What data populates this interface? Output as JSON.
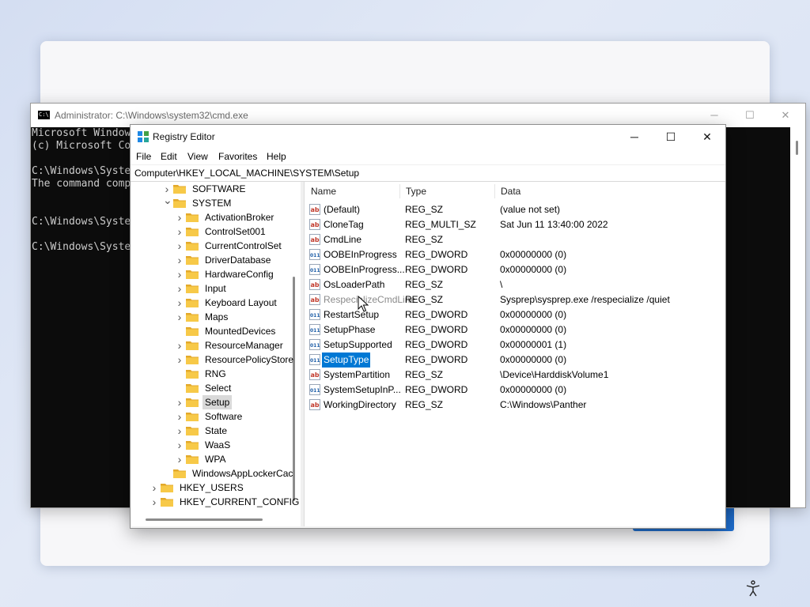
{
  "cmd": {
    "title": "Administrator: C:\\Windows\\system32\\cmd.exe",
    "icon_label": "C:\\",
    "lines": [
      "Microsoft Window",
      "(c) Microsoft Co",
      "",
      "C:\\Windows\\Syste",
      "The command comp",
      "",
      "",
      "C:\\Windows\\Syste",
      "",
      "C:\\Windows\\Syste"
    ]
  },
  "regedit": {
    "title": "Registry Editor",
    "menu": [
      "File",
      "Edit",
      "View",
      "Favorites",
      "Help"
    ],
    "address": "Computer\\HKEY_LOCAL_MACHINE\\SYSTEM\\Setup",
    "tree": [
      {
        "label": "SOFTWARE",
        "expander": "collapsed",
        "level": 1
      },
      {
        "label": "SYSTEM",
        "expander": "expanded",
        "level": 1
      },
      {
        "label": "ActivationBroker",
        "expander": "collapsed",
        "level": 2
      },
      {
        "label": "ControlSet001",
        "expander": "collapsed",
        "level": 2
      },
      {
        "label": "CurrentControlSet",
        "expander": "collapsed",
        "level": 2
      },
      {
        "label": "DriverDatabase",
        "expander": "collapsed",
        "level": 2
      },
      {
        "label": "HardwareConfig",
        "expander": "collapsed",
        "level": 2
      },
      {
        "label": "Input",
        "expander": "collapsed",
        "level": 2
      },
      {
        "label": "Keyboard Layout",
        "expander": "collapsed",
        "level": 2
      },
      {
        "label": "Maps",
        "expander": "collapsed",
        "level": 2
      },
      {
        "label": "MountedDevices",
        "expander": "none",
        "level": 2
      },
      {
        "label": "ResourceManager",
        "expander": "collapsed",
        "level": 2
      },
      {
        "label": "ResourcePolicyStore",
        "expander": "collapsed",
        "level": 2
      },
      {
        "label": "RNG",
        "expander": "none",
        "level": 2
      },
      {
        "label": "Select",
        "expander": "none",
        "level": 2
      },
      {
        "label": "Setup",
        "expander": "collapsed",
        "level": 2,
        "selected": true
      },
      {
        "label": "Software",
        "expander": "collapsed",
        "level": 2
      },
      {
        "label": "State",
        "expander": "collapsed",
        "level": 2
      },
      {
        "label": "WaaS",
        "expander": "collapsed",
        "level": 2
      },
      {
        "label": "WPA",
        "expander": "collapsed",
        "level": 2
      },
      {
        "label": "WindowsAppLockerCac",
        "expander": "none",
        "level": 1
      },
      {
        "label": "HKEY_USERS",
        "expander": "collapsed",
        "level": 0
      },
      {
        "label": "HKEY_CURRENT_CONFIG",
        "expander": "collapsed",
        "level": 0
      }
    ],
    "columns": {
      "name": "Name",
      "type": "Type",
      "data": "Data"
    },
    "values": [
      {
        "name": "(Default)",
        "type": "REG_SZ",
        "data": "(value not set)",
        "kind": "sz"
      },
      {
        "name": "CloneTag",
        "type": "REG_MULTI_SZ",
        "data": "Sat Jun 11 13:40:00 2022",
        "kind": "sz"
      },
      {
        "name": "CmdLine",
        "type": "REG_SZ",
        "data": "",
        "kind": "sz"
      },
      {
        "name": "OOBEInProgress",
        "type": "REG_DWORD",
        "data": "0x00000000 (0)",
        "kind": "dword"
      },
      {
        "name": "OOBEInProgress...",
        "type": "REG_DWORD",
        "data": "0x00000000 (0)",
        "kind": "dword"
      },
      {
        "name": "OsLoaderPath",
        "type": "REG_SZ",
        "data": "\\",
        "kind": "sz"
      },
      {
        "name": "RespecializeCmdLine",
        "type": "REG_SZ",
        "data": "Sysprep\\sysprep.exe /respecialize /quiet",
        "kind": "sz",
        "hover": true
      },
      {
        "name": "RestartSetup",
        "type": "REG_DWORD",
        "data": "0x00000000 (0)",
        "kind": "dword"
      },
      {
        "name": "SetupPhase",
        "type": "REG_DWORD",
        "data": "0x00000000 (0)",
        "kind": "dword"
      },
      {
        "name": "SetupSupported",
        "type": "REG_DWORD",
        "data": "0x00000001 (1)",
        "kind": "dword"
      },
      {
        "name": "SetupType",
        "type": "REG_DWORD",
        "data": "0x00000000 (0)",
        "kind": "dword",
        "selected": true
      },
      {
        "name": "SystemPartition",
        "type": "REG_SZ",
        "data": "\\Device\\HarddiskVolume1",
        "kind": "sz"
      },
      {
        "name": "SystemSetupInP...",
        "type": "REG_DWORD",
        "data": "0x00000000 (0)",
        "kind": "dword"
      },
      {
        "name": "WorkingDirectory",
        "type": "REG_SZ",
        "data": "C:\\Windows\\Panther",
        "kind": "sz"
      }
    ]
  },
  "colors": {
    "accent": "#0078d4",
    "folder": "#f7c948",
    "setup_button": "#1f6fd0"
  }
}
